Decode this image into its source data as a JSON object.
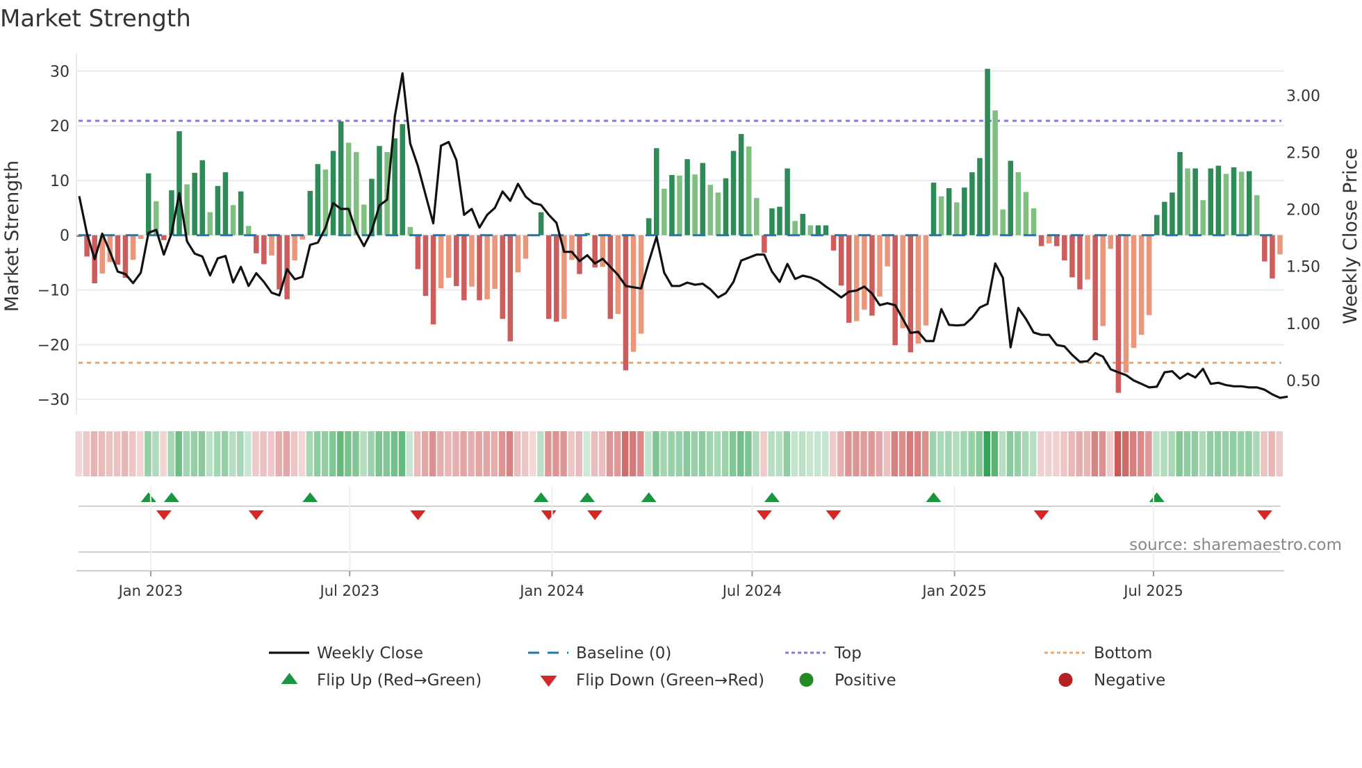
{
  "title": "Market Strength",
  "source": "source: sharemaestro.com",
  "chart_data": {
    "type": "bar",
    "start_date": "2022-10-28",
    "frequency": "weekly",
    "title": "Market Strength",
    "ylabel": "Market Strength",
    "y2label": "Weekly Close Price",
    "ylim": [
      -32.9,
      32.7
    ],
    "y2lim": [
      0.195,
      3.343
    ],
    "yticks": [
      30,
      20,
      10,
      0,
      -10,
      -20,
      -30
    ],
    "ytick_labels": [
      "30",
      "20",
      "10",
      "0",
      "−10",
      "−20",
      "−30"
    ],
    "y2ticks": [
      3.0,
      2.5,
      2.0,
      1.5,
      1.0,
      0.5
    ],
    "y2tick_labels": [
      "3.00",
      "2.50",
      "2.00",
      "1.50",
      "1.00",
      "0.50"
    ],
    "xticks": [
      {
        "date": "2023-01-01",
        "label": "Jan 2023"
      },
      {
        "date": "2023-07-01",
        "label": "Jul 2023"
      },
      {
        "date": "2024-01-01",
        "label": "Jan 2024"
      },
      {
        "date": "2024-07-01",
        "label": "Jul 2024"
      },
      {
        "date": "2025-01-01",
        "label": "Jan 2025"
      },
      {
        "date": "2025-07-01",
        "label": "Jul 2025"
      }
    ],
    "grid": true,
    "reference_lines": {
      "top": 20.9,
      "bottom": -23.3,
      "baseline": 0
    },
    "strength": [
      -0.3,
      -3.9,
      -8.8,
      -7,
      -4.9,
      -5.4,
      -7.8,
      -4.5,
      -0.7,
      11.3,
      6.2,
      -0.9,
      8.2,
      19,
      9.3,
      11.4,
      13.7,
      4.2,
      9,
      11.5,
      5.5,
      8,
      1.7,
      -3.3,
      -5.3,
      -3.7,
      -9.9,
      -11.7,
      -4.6,
      -0.8,
      8.1,
      13,
      12,
      15.4,
      20.8,
      16.9,
      15.2,
      5.6,
      10.3,
      16.3,
      15.2,
      17.7,
      20.3,
      1.5,
      -6.2,
      -11.1,
      -16.3,
      -9.7,
      -7.8,
      -9.3,
      -11.9,
      -9.4,
      -11.9,
      -11.7,
      -9.8,
      -15.3,
      -19.4,
      -6.8,
      -4.3,
      -0.2,
      4.2,
      -15.3,
      -15.8,
      -15.3,
      -4.5,
      -7.1,
      0.4,
      -5.9,
      -5.8,
      -15.3,
      -14.4,
      -24.7,
      -21.3,
      -18,
      3.1,
      15.9,
      8.5,
      11,
      10.9,
      13.9,
      11.1,
      13.2,
      9.2,
      7.8,
      10.4,
      15.4,
      18.5,
      16.2,
      6.8,
      -3.2,
      4.9,
      5.2,
      12.2,
      2.6,
      3.9,
      1.8,
      1.8,
      1.8,
      -2.8,
      -9.2,
      -16,
      -15.7,
      -13.6,
      -14.7,
      -11.2,
      -5.7,
      -20.1,
      -17,
      -21.4,
      -19.8,
      -16.5,
      9.6,
      7.1,
      8.6,
      6,
      8.7,
      11.5,
      14.1,
      30.4,
      22.8,
      4.7,
      13.6,
      11.5,
      7.9,
      4.9,
      -2,
      -1.5,
      -2,
      -4.6,
      -7.7,
      -9.9,
      -8.1,
      -19.2,
      -16.6,
      -2.5,
      -28.8,
      -25.1,
      -20.6,
      -18.2,
      -14.6,
      3.7,
      6.1,
      7.8,
      15.2,
      12.2,
      12.2,
      6.4,
      12.2,
      12.7,
      11.2,
      12.4,
      11.6,
      11.7,
      7.3,
      -4.8,
      -7.9,
      -3.5
    ],
    "weekly_close": [
      2.116,
      1.79,
      1.563,
      1.787,
      1.628,
      1.455,
      1.433,
      1.354,
      1.445,
      1.795,
      1.821,
      1.604,
      1.79,
      2.144,
      1.72,
      1.612,
      1.587,
      1.421,
      1.571,
      1.591,
      1.36,
      1.496,
      1.329,
      1.441,
      1.364,
      1.27,
      1.246,
      1.476,
      1.388,
      1.409,
      1.689,
      1.709,
      1.841,
      2.055,
      2.004,
      2.004,
      1.8,
      1.679,
      1.811,
      2.035,
      2.085,
      2.817,
      3.193,
      2.579,
      2.38,
      2.126,
      1.878,
      2.559,
      2.591,
      2.431,
      1.953,
      2.004,
      1.841,
      1.953,
      2.014,
      2.157,
      2.075,
      2.224,
      2.112,
      2.055,
      2.039,
      1.953,
      1.882,
      1.628,
      1.628,
      1.547,
      1.598,
      1.526,
      1.567,
      1.496,
      1.425,
      1.329,
      1.317,
      1.307,
      1.541,
      1.76,
      1.445,
      1.329,
      1.329,
      1.358,
      1.339,
      1.348,
      1.299,
      1.228,
      1.266,
      1.364,
      1.551,
      1.577,
      1.604,
      1.604,
      1.455,
      1.364,
      1.522,
      1.39,
      1.419,
      1.404,
      1.374,
      1.323,
      1.278,
      1.228,
      1.278,
      1.289,
      1.323,
      1.262,
      1.161,
      1.177,
      1.161,
      1.039,
      0.917,
      0.927,
      0.846,
      0.846,
      1.126,
      0.988,
      0.982,
      0.988,
      1.049,
      1.14,
      1.171,
      1.526,
      1.4,
      0.791,
      1.136,
      1.039,
      0.921,
      0.9,
      0.9,
      0.811,
      0.799,
      0.724,
      0.663,
      0.669,
      0.74,
      0.709,
      0.598,
      0.571,
      0.547,
      0.5,
      0.47,
      0.439,
      0.445,
      0.571,
      0.581,
      0.516,
      0.561,
      0.526,
      0.602,
      0.47,
      0.48,
      0.459,
      0.449,
      0.449,
      0.439,
      0.439,
      0.419,
      0.378,
      0.348,
      0.358
    ],
    "legend": {
      "placement": "bottom",
      "items": [
        {
          "key": "close",
          "label": "Weekly Close"
        },
        {
          "key": "baseline",
          "label": "Baseline (0)"
        },
        {
          "key": "top",
          "label": "Top"
        },
        {
          "key": "bottom",
          "label": "Bottom"
        },
        {
          "key": "flip_up",
          "label": "Flip Up (Red→Green)"
        },
        {
          "key": "flip_down",
          "label": "Flip Down (Green→Red)"
        },
        {
          "key": "positive",
          "label": "Positive"
        },
        {
          "key": "negative",
          "label": "Negative"
        }
      ]
    }
  },
  "colors": {
    "pos_rising": "#2e8b57",
    "pos_falling": "#7fbf7f",
    "neg_falling": "#cd5c5c",
    "neg_rising": "#e9967a",
    "baseline": "#1f77b4",
    "top": "#9370db",
    "bottom": "#f4a460",
    "line": "#111111",
    "flip_up": "#1a9641",
    "flip_down": "#d62728",
    "positive_dot": "#228b22",
    "negative_dot": "#b22222",
    "grid": "#e8ebf0"
  }
}
